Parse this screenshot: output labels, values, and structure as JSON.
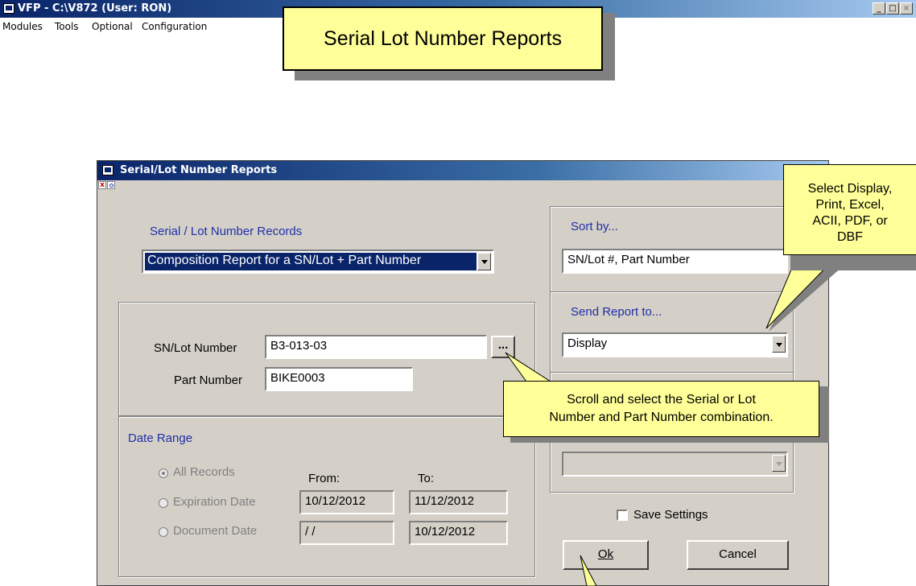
{
  "app": {
    "title": "VFP - C:\\V872  (User: RON)",
    "min": "_",
    "max": "□",
    "close": "×"
  },
  "menu": [
    "Modules",
    "Tools",
    "Optional",
    "Configuration"
  ],
  "callouts": {
    "title": "Serial Lot Number Reports",
    "output": [
      "Select Display,",
      "Print, Excel,",
      "ACII, PDF, or",
      "DBF"
    ],
    "scroll": [
      "Scroll and select the Serial or Lot",
      "Number and Part Number combination."
    ]
  },
  "dialog": {
    "title": "Serial/Lot Number Reports",
    "records_label": "Serial / Lot Number Records",
    "records_value": "Composition Report for a SN/Lot + Part Number",
    "sn_label": "SN/Lot Number",
    "sn_value": "B3-013-03",
    "ellipsis": "...",
    "part_label": "Part Number",
    "part_value": "BIKE0003",
    "date_range": "Date Range",
    "all_records": "All Records",
    "expiration_date": "Expiration Date",
    "document_date": "Document Date",
    "from_label": "From:",
    "to_label": "To:",
    "exp_from": "10/12/2012",
    "exp_to": "11/12/2012",
    "doc_from": " / /",
    "doc_to": "10/12/2012",
    "sort_label": "Sort by...",
    "sort_value": "SN/Lot #, Part Number",
    "send_label": "Send Report to...",
    "send_value": "Display",
    "save_settings": "Save Settings",
    "ok": "Ok",
    "cancel": "Cancel"
  },
  "colors": {
    "callout_bg": "#ffff99",
    "dialog_bg": "#d4d0c8",
    "title_blue": "#0a246a",
    "label_blue": "#1f2fa8"
  }
}
